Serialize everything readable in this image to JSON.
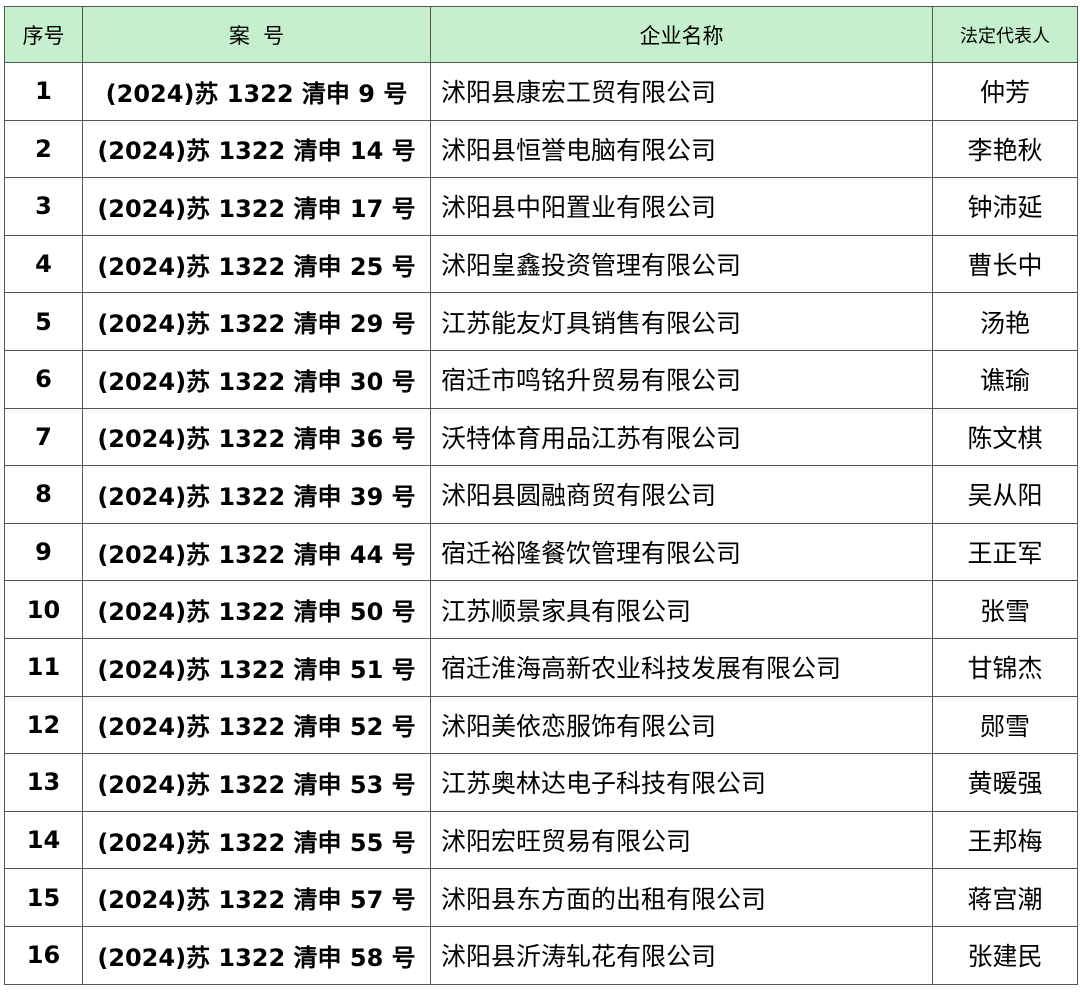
{
  "headers": {
    "index": "序号",
    "case": "案  号",
    "company": "企业名称",
    "rep": "法定代表人"
  },
  "rows": [
    {
      "idx": "1",
      "case": "(2024)苏 1322 清申 9 号",
      "company": "沭阳县康宏工贸有限公司",
      "rep": "仲芳"
    },
    {
      "idx": "2",
      "case": "(2024)苏 1322 清申 14 号",
      "company": "沭阳县恒誉电脑有限公司",
      "rep": "李艳秋"
    },
    {
      "idx": "3",
      "case": "(2024)苏 1322 清申 17 号",
      "company": "沭阳县中阳置业有限公司",
      "rep": "钟沛延"
    },
    {
      "idx": "4",
      "case": "(2024)苏 1322 清申 25 号",
      "company": "沭阳皇鑫投资管理有限公司",
      "rep": "曹长中"
    },
    {
      "idx": "5",
      "case": "(2024)苏 1322 清申 29 号",
      "company": "江苏能友灯具销售有限公司",
      "rep": "汤艳"
    },
    {
      "idx": "6",
      "case": "(2024)苏 1322 清申 30 号",
      "company": "宿迁市鸣铭升贸易有限公司",
      "rep": "谯瑜"
    },
    {
      "idx": "7",
      "case": "(2024)苏 1322 清申 36 号",
      "company": "沃特体育用品江苏有限公司",
      "rep": "陈文棋"
    },
    {
      "idx": "8",
      "case": "(2024)苏 1322 清申 39 号",
      "company": "沭阳县圆融商贸有限公司",
      "rep": "吴从阳"
    },
    {
      "idx": "9",
      "case": "(2024)苏 1322 清申 44 号",
      "company": "宿迁裕隆餐饮管理有限公司",
      "rep": "王正军"
    },
    {
      "idx": "10",
      "case": "(2024)苏 1322 清申 50 号",
      "company": "江苏顺景家具有限公司",
      "rep": "张雪"
    },
    {
      "idx": "11",
      "case": "(2024)苏 1322 清申 51 号",
      "company": "宿迁淮海高新农业科技发展有限公司",
      "rep": "甘锦杰"
    },
    {
      "idx": "12",
      "case": "(2024)苏 1322 清申 52 号",
      "company": "沭阳美依恋服饰有限公司",
      "rep": "郧雪"
    },
    {
      "idx": "13",
      "case": "(2024)苏 1322 清申 53 号",
      "company": "江苏奥林达电子科技有限公司",
      "rep": "黄暖强"
    },
    {
      "idx": "14",
      "case": "(2024)苏 1322 清申 55 号",
      "company": "沭阳宏旺贸易有限公司",
      "rep": "王邦梅"
    },
    {
      "idx": "15",
      "case": "(2024)苏 1322 清申 57 号",
      "company": "沭阳县东方面的出租有限公司",
      "rep": "蒋宫潮"
    },
    {
      "idx": "16",
      "case": "(2024)苏 1322 清申 58 号",
      "company": "沭阳县沂涛轧花有限公司",
      "rep": "张建民"
    }
  ]
}
